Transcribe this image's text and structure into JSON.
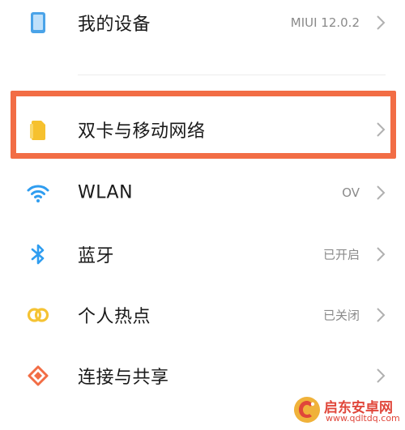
{
  "settings": {
    "items": [
      {
        "label": "我的设备",
        "value": "MIUI 12.0.2",
        "icon": "phone-icon"
      },
      {
        "label": "双卡与移动网络",
        "value": "",
        "icon": "sim-card-icon"
      },
      {
        "label": "WLAN",
        "value": "OV",
        "icon": "wifi-icon"
      },
      {
        "label": "蓝牙",
        "value": "已开启",
        "icon": "bluetooth-icon"
      },
      {
        "label": "个人热点",
        "value": "已关闭",
        "icon": "hotspot-icon"
      },
      {
        "label": "连接与共享",
        "value": "",
        "icon": "share-icon"
      }
    ]
  },
  "watermark": {
    "title": "启东安卓网",
    "url": "www.qdltdq.com"
  },
  "colors": {
    "highlight": "#f26d45",
    "device_icon": "#4aa3e8",
    "sim_icon": "#f6c12e",
    "wifi_icon": "#2f9df0",
    "bluetooth_icon": "#2f9df0",
    "hotspot_icon": "#f5c334",
    "share_icon": "#f26d45"
  }
}
